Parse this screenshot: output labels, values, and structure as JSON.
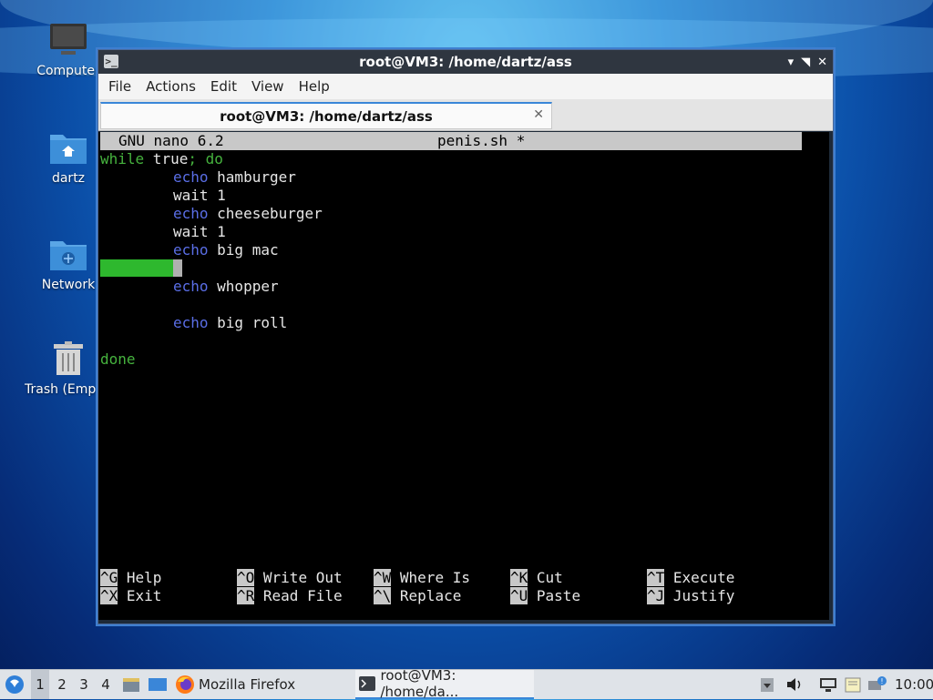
{
  "desktop": {
    "icons": [
      {
        "label": "Computer"
      },
      {
        "label": "dartz"
      },
      {
        "label": "Network"
      },
      {
        "label": "Trash (Empty)"
      }
    ]
  },
  "window": {
    "title": "root@VM3: /home/dartz/ass",
    "controls": {
      "minimize": "▾",
      "restore": "◥",
      "close": "✕"
    },
    "menu": [
      "File",
      "Actions",
      "Edit",
      "View",
      "Help"
    ],
    "tab": {
      "label": "root@VM3: /home/dartz/ass",
      "close": "✕"
    }
  },
  "nano": {
    "version": "GNU nano 6.2",
    "filename": "penis.sh *",
    "lines": {
      "l1_kw": "while",
      "l1_rest": " true",
      "l1_sep": "; do",
      "l2_kw": "echo",
      "l2_rest": " hamburger",
      "l3": "wait 1",
      "l4_kw": "echo",
      "l4_rest": " cheeseburger",
      "l5": "wait 1",
      "l6_kw": "echo",
      "l6_rest": " big mac",
      "l8_kw": "echo",
      "l8_rest": " whopper",
      "l10_kw": "echo",
      "l10_rest": " big roll",
      "l12": "done"
    },
    "shortcuts": [
      {
        "key": "^G",
        "label": "Help"
      },
      {
        "key": "^O",
        "label": "Write Out"
      },
      {
        "key": "^W",
        "label": "Where Is"
      },
      {
        "key": "^K",
        "label": "Cut"
      },
      {
        "key": "^T",
        "label": "Execute"
      },
      {
        "key": "^X",
        "label": "Exit"
      },
      {
        "key": "^R",
        "label": "Read File"
      },
      {
        "key": "^\\",
        "label": "Replace"
      },
      {
        "key": "^U",
        "label": "Paste"
      },
      {
        "key": "^J",
        "label": "Justify"
      }
    ]
  },
  "taskbar": {
    "workspaces": [
      "1",
      "2",
      "3",
      "4"
    ],
    "firefox": "Mozilla Firefox",
    "terminal": "root@VM3: /home/da...",
    "clock": "10:00"
  },
  "colors": {
    "accent": "#3a86d8",
    "keyword": "#5a6ee6",
    "green": "#46b33e"
  }
}
